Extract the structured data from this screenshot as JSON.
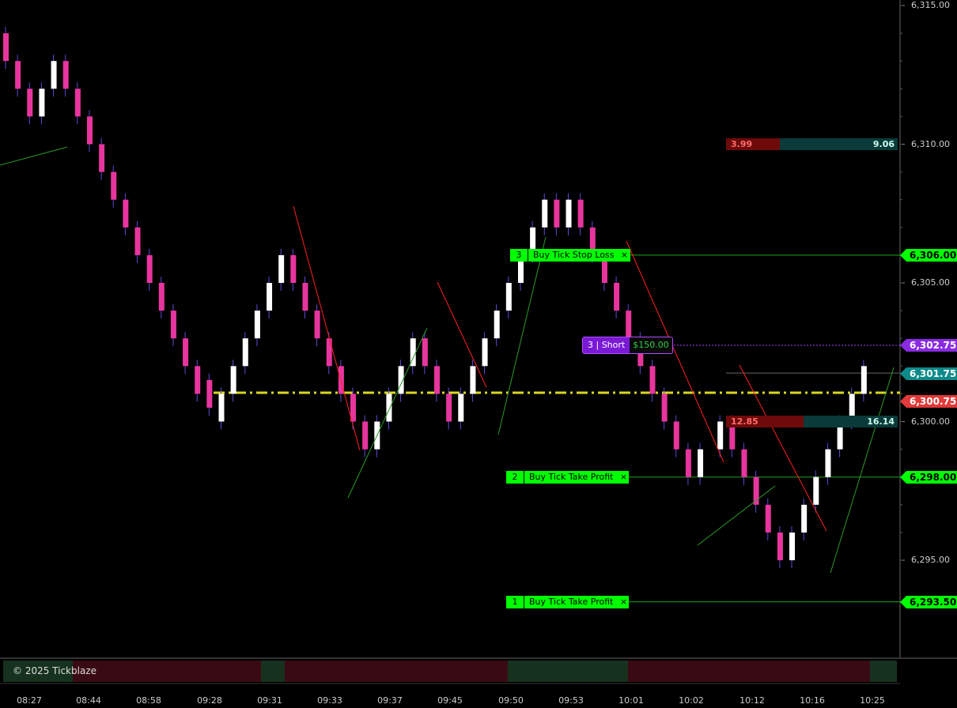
{
  "y_axis": {
    "ticks": [
      "6,315.00",
      "6,310.00",
      "6,305.00",
      "6,300.00",
      "6,295.00"
    ],
    "tick_values": [
      6315,
      6310,
      6305,
      6300,
      6295
    ]
  },
  "x_axis": {
    "ticks": [
      "08:27",
      "08:44",
      "08:58",
      "09:28",
      "09:31",
      "09:33",
      "09:37",
      "09:45",
      "09:50",
      "09:53",
      "10:01",
      "10:02",
      "10:12",
      "10:16",
      "10:25"
    ]
  },
  "orders": [
    {
      "qty": "3",
      "label": "Buy Tick Stop Loss",
      "close": "×",
      "price": 6306.0,
      "flag": "6,306.00"
    },
    {
      "qty": "2",
      "label": "Buy Tick Take Profit",
      "close": "×",
      "price": 6298.0,
      "flag": "6,298.00"
    },
    {
      "qty": "1",
      "label": "Buy Tick Take Profit",
      "close": "×",
      "price": 6293.5,
      "flag": "6,293.50"
    }
  ],
  "position": {
    "qty_side": "3 | Short",
    "pnl": "$150.00",
    "price": 6302.75,
    "flag": "6,302.75"
  },
  "last_price": {
    "flag": "6,301.75",
    "price": 6301.75
  },
  "avg_line": {
    "flag": "6,300.75",
    "price": 6300.75
  },
  "ratio_bars": [
    {
      "left": "3.99",
      "right": "9.06"
    },
    {
      "left": "12.85",
      "right": "16.14"
    }
  ],
  "footer": {
    "copyright": "© 2025 Tickblaze"
  },
  "colors": {
    "up_candle": "#ffffff",
    "down_candle": "#e8359e",
    "wick": "#5a4bd6",
    "order_green": "#00ff00",
    "position_purple": "#7a1ad6",
    "last_teal": "#0e8a8a",
    "avg_red": "#e03a3a",
    "dashed_yellow": "#d8d820"
  }
}
